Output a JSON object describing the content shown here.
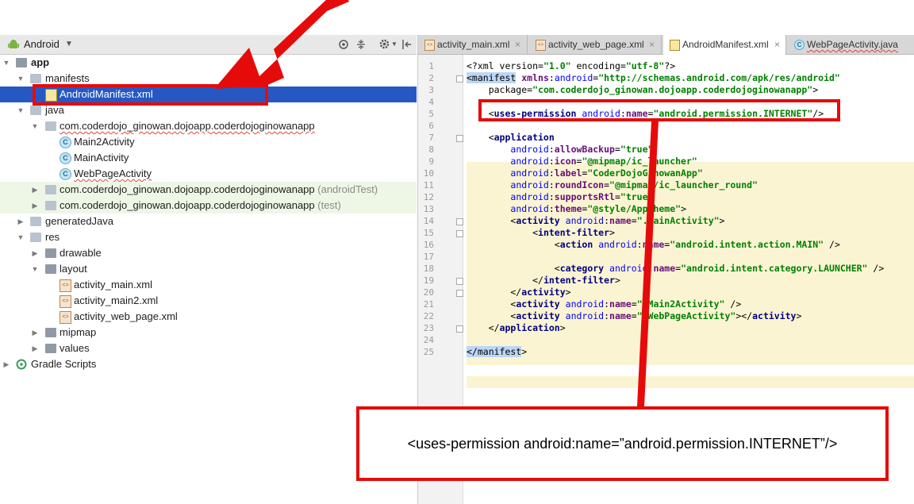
{
  "project_toolbar": {
    "view_selector": "Android",
    "icons": [
      "locate-icon",
      "collapse-icon",
      "gear-icon",
      "hide-icon"
    ]
  },
  "tree": [
    {
      "label": "app",
      "bold": true,
      "icon": "module-icon",
      "arrow": "down"
    },
    {
      "label": "manifests",
      "icon": "folder-icon",
      "arrow": "down"
    },
    {
      "label": "AndroidManifest.xml",
      "icon": "manifest-icon",
      "selected": true
    },
    {
      "label": "java",
      "icon": "folder-icon",
      "arrow": "down"
    },
    {
      "label": "com.coderdojo_ginowan.dojoapp.coderdojoginowanapp",
      "icon": "package-icon",
      "arrow": "down"
    },
    {
      "label": "Main2Activity",
      "icon": "class-icon"
    },
    {
      "label": "MainActivity",
      "icon": "class-icon"
    },
    {
      "label": "WebPageActivity",
      "icon": "class-icon"
    },
    {
      "label": "com.coderdojo_ginowan.dojoapp.coderdojoginowanapp",
      "suffix": "(androidTest)",
      "icon": "package-icon",
      "arrow": "right"
    },
    {
      "label": "com.coderdojo_ginowan.dojoapp.coderdojoginowanapp",
      "suffix": "(test)",
      "icon": "package-icon",
      "arrow": "right"
    },
    {
      "label": "generatedJava",
      "icon": "generated-folder-icon",
      "arrow": "right"
    },
    {
      "label": "res",
      "icon": "res-folder-icon",
      "arrow": "down"
    },
    {
      "label": "drawable",
      "icon": "folder-icon",
      "arrow": "right"
    },
    {
      "label": "layout",
      "icon": "folder-icon",
      "arrow": "down"
    },
    {
      "label": "activity_main.xml",
      "icon": "layout-xml-icon"
    },
    {
      "label": "activity_main2.xml",
      "icon": "layout-xml-icon"
    },
    {
      "label": "activity_web_page.xml",
      "icon": "layout-xml-icon"
    },
    {
      "label": "mipmap",
      "icon": "folder-icon",
      "arrow": "right"
    },
    {
      "label": "values",
      "icon": "folder-icon",
      "arrow": "right"
    },
    {
      "label": "Gradle Scripts",
      "icon": "gradle-icon",
      "arrow": "right"
    }
  ],
  "tabs": [
    {
      "label": "activity_main.xml",
      "icon": "layout-xml-icon",
      "close": "×"
    },
    {
      "label": "activity_web_page.xml",
      "icon": "layout-xml-icon",
      "close": "×"
    },
    {
      "label": "AndroidManifest.xml",
      "icon": "manifest-icon",
      "close": "×",
      "active": true
    },
    {
      "label": "WebPageActivity.java",
      "icon": "class-icon",
      "close": ""
    }
  ],
  "code": {
    "line_numbers": [
      "1",
      "2",
      "3",
      "4",
      "5",
      "6",
      "7",
      "8",
      "9",
      "10",
      "11",
      "12",
      "13",
      "14",
      "15",
      "16",
      "17",
      "18",
      "19",
      "20",
      "21",
      "22",
      "23",
      "24",
      "25"
    ],
    "lines": [
      "<?xml version=\"1.0\" encoding=\"utf-8\"?>",
      "<manifest xmlns:android=\"http://schemas.android.com/apk/res/android\"",
      "    package=\"com.coderdojo_ginowan.dojoapp.coderdojoginowanapp\">",
      "",
      "    <uses-permission android:name=\"android.permission.INTERNET\"/>",
      "",
      "    <application",
      "        android:allowBackup=\"true\"",
      "        android:icon=\"@mipmap/ic_launcher\"",
      "        android:label=\"CoderDojoGinowanApp\"",
      "        android:roundIcon=\"@mipmap/ic_launcher_round\"",
      "        android:supportsRtl=\"true\"",
      "        android:theme=\"@style/AppTheme\">",
      "        <activity android:name=\".MainActivity\">",
      "            <intent-filter>",
      "                <action android:name=\"android.intent.action.MAIN\" />",
      "",
      "                <category android:name=\"android.intent.category.LAUNCHER\" />",
      "            </intent-filter>",
      "        </activity>",
      "        <activity android:name=\".Main2Activity\" />",
      "        <activity android:name=\".WebPageActivity\"></activity>",
      "    </application>",
      "",
      "</manifest>"
    ]
  },
  "callout": {
    "text": "<uses-permission android:name=”android.permission.INTERNET”/>"
  },
  "colors": {
    "annotation_red": "#e60b0b",
    "selection_blue": "#2658c4",
    "tag_navy": "#000080",
    "attr_purple": "#660e7a",
    "value_green": "#008000"
  }
}
